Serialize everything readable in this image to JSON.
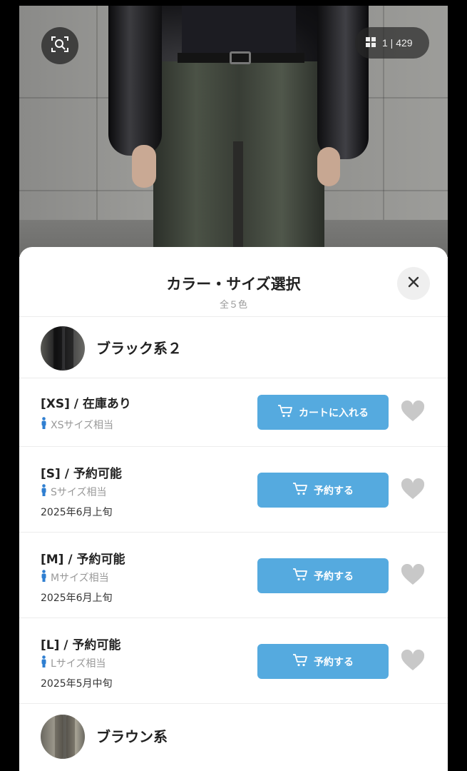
{
  "photo": {
    "counter": "1 | 429"
  },
  "sheet": {
    "title": "カラー・サイズ選択",
    "subtitle": "全５色"
  },
  "colors": [
    {
      "name": "ブラック系２",
      "rows": [
        {
          "size": "[XS] /  在庫あり",
          "fit": "XSサイズ相当",
          "date": "",
          "cta": "カートに入れる"
        },
        {
          "size": "[S] /  予約可能",
          "fit": "Sサイズ相当",
          "date": "2025年6月上旬",
          "cta": "予約する"
        },
        {
          "size": "[M] /  予約可能",
          "fit": "Mサイズ相当",
          "date": "2025年6月上旬",
          "cta": "予約する"
        },
        {
          "size": "[L] /  予約可能",
          "fit": "Lサイズ相当",
          "date": "2025年5月中旬",
          "cta": "予約する"
        }
      ]
    },
    {
      "name": "ブラウン系",
      "rows": []
    }
  ],
  "icons": {
    "lens": "image-search-icon",
    "grid": "grid-icon",
    "close": "close-icon",
    "cart": "cart-icon",
    "heart": "heart-icon",
    "person": "person-icon"
  },
  "colors_ui": {
    "cta": "#55aadf",
    "heart": "#c8c8c8",
    "fit_icon": "#2f7fd1"
  }
}
